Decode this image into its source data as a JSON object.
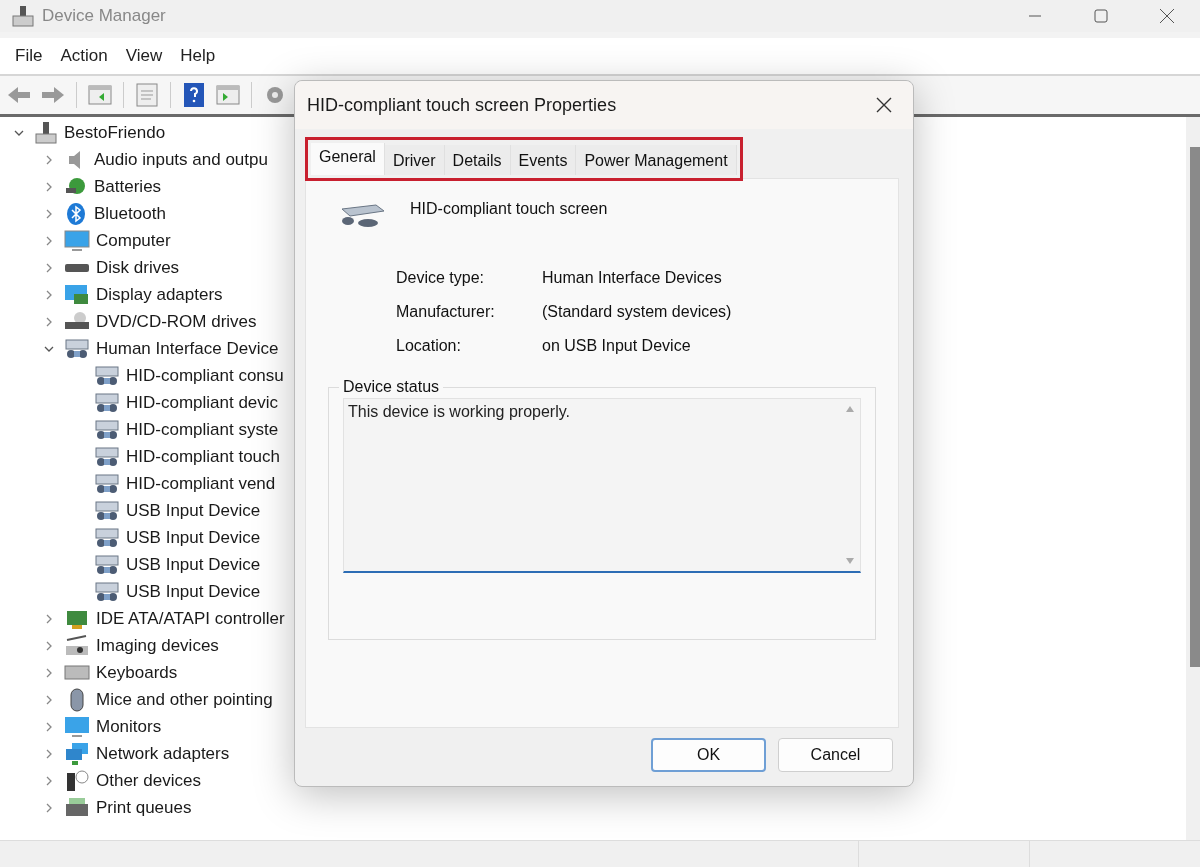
{
  "window": {
    "title": "Device Manager"
  },
  "menu": [
    "File",
    "Action",
    "View",
    "Help"
  ],
  "tree": {
    "label": "BestoFriendo",
    "expanded": true,
    "children": [
      {
        "label": "Audio inputs and outpu",
        "expanded": false
      },
      {
        "label": "Batteries",
        "expanded": false
      },
      {
        "label": "Bluetooth",
        "expanded": false
      },
      {
        "label": "Computer",
        "expanded": false
      },
      {
        "label": "Disk drives",
        "expanded": false
      },
      {
        "label": "Display adapters",
        "expanded": false
      },
      {
        "label": "DVD/CD-ROM drives",
        "expanded": false
      },
      {
        "label": "Human Interface Device",
        "expanded": true,
        "children": [
          {
            "label": "HID-compliant consu"
          },
          {
            "label": "HID-compliant devic"
          },
          {
            "label": "HID-compliant syste"
          },
          {
            "label": "HID-compliant touch"
          },
          {
            "label": "HID-compliant vend"
          },
          {
            "label": "USB Input Device"
          },
          {
            "label": "USB Input Device"
          },
          {
            "label": "USB Input Device"
          },
          {
            "label": "USB Input Device"
          }
        ]
      },
      {
        "label": "IDE ATA/ATAPI controller",
        "expanded": false
      },
      {
        "label": "Imaging devices",
        "expanded": false
      },
      {
        "label": "Keyboards",
        "expanded": false
      },
      {
        "label": "Mice and other pointing",
        "expanded": false
      },
      {
        "label": "Monitors",
        "expanded": false
      },
      {
        "label": "Network adapters",
        "expanded": false
      },
      {
        "label": "Other devices",
        "expanded": false
      },
      {
        "label": "Print queues",
        "expanded": false
      }
    ]
  },
  "dialog": {
    "title": "HID-compliant touch screen Properties",
    "tabs_highlighted": true,
    "tabs": [
      {
        "label": "General",
        "selected": true
      },
      {
        "label": "Driver",
        "selected": false
      },
      {
        "label": "Details",
        "selected": false
      },
      {
        "label": "Events",
        "selected": false
      },
      {
        "label": "Power Management",
        "selected": false
      }
    ],
    "device_name": "HID-compliant touch screen",
    "properties": [
      {
        "label": "Device type:",
        "value": "Human Interface Devices"
      },
      {
        "label": "Manufacturer:",
        "value": "(Standard system devices)"
      },
      {
        "label": "Location:",
        "value": "on USB Input Device"
      }
    ],
    "status_group": {
      "title": "Device status",
      "text": "This device is working properly."
    },
    "buttons": [
      {
        "label": "OK",
        "default": true
      },
      {
        "label": "Cancel",
        "default": false
      }
    ]
  }
}
